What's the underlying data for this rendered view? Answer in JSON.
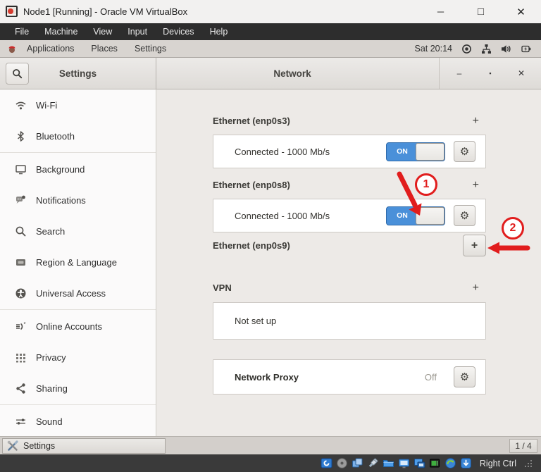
{
  "window": {
    "title": "Node1 [Running] - Oracle VM VirtualBox"
  },
  "menu_bar": {
    "items": [
      "File",
      "Machine",
      "View",
      "Input",
      "Devices",
      "Help"
    ]
  },
  "top_bar": {
    "menus": [
      "Applications",
      "Places",
      "Settings"
    ],
    "clock": "Sat 20:14",
    "tray_icons": [
      "screencast-icon",
      "network-wired-icon",
      "volume-icon",
      "battery-charging-icon"
    ]
  },
  "settings": {
    "left_title": "Settings",
    "panel_title": "Network",
    "sidebar": [
      {
        "label": "Wi-Fi",
        "icon": "wifi-icon"
      },
      {
        "label": "Bluetooth",
        "icon": "bluetooth-icon"
      },
      {
        "label": "Background",
        "icon": "background-icon"
      },
      {
        "label": "Notifications",
        "icon": "notifications-icon"
      },
      {
        "label": "Search",
        "icon": "search-icon"
      },
      {
        "label": "Region & Language",
        "icon": "region-language-icon"
      },
      {
        "label": "Universal Access",
        "icon": "universal-access-icon"
      },
      {
        "label": "Online Accounts",
        "icon": "online-accounts-icon"
      },
      {
        "label": "Privacy",
        "icon": "privacy-icon"
      },
      {
        "label": "Sharing",
        "icon": "sharing-icon"
      },
      {
        "label": "Sound",
        "icon": "sound-icon"
      }
    ],
    "network": {
      "eth1": {
        "label": "Ethernet (enp0s3)",
        "add": "+",
        "status": "Connected - 1000 Mb/s",
        "toggle": "ON"
      },
      "eth2": {
        "label": "Ethernet (enp0s8)",
        "add": "+",
        "status": "Connected - 1000 Mb/s",
        "toggle": "ON"
      },
      "eth3": {
        "label": "Ethernet (enp0s9)",
        "add": "+"
      },
      "vpn": {
        "label": "VPN",
        "add": "+",
        "status": "Not set up"
      },
      "proxy": {
        "label": "Network Proxy",
        "value": "Off"
      }
    },
    "accent_color": "#4a90d9"
  },
  "taskbar": {
    "task_label": "Settings",
    "pager": "1 / 4"
  },
  "status_bar": {
    "host_key": "Right Ctrl",
    "icons": [
      "hard-disks-icon",
      "optical-drives-icon",
      "audio-icon",
      "usb-icon",
      "shared-folders-icon",
      "display-icon",
      "video-capture-icon",
      "network-icon",
      "shared-clipboard-icon",
      "mouse-integration-icon"
    ]
  },
  "annotations": {
    "step1": "1",
    "step2": "2",
    "arrow_color": "#e11d1d"
  }
}
